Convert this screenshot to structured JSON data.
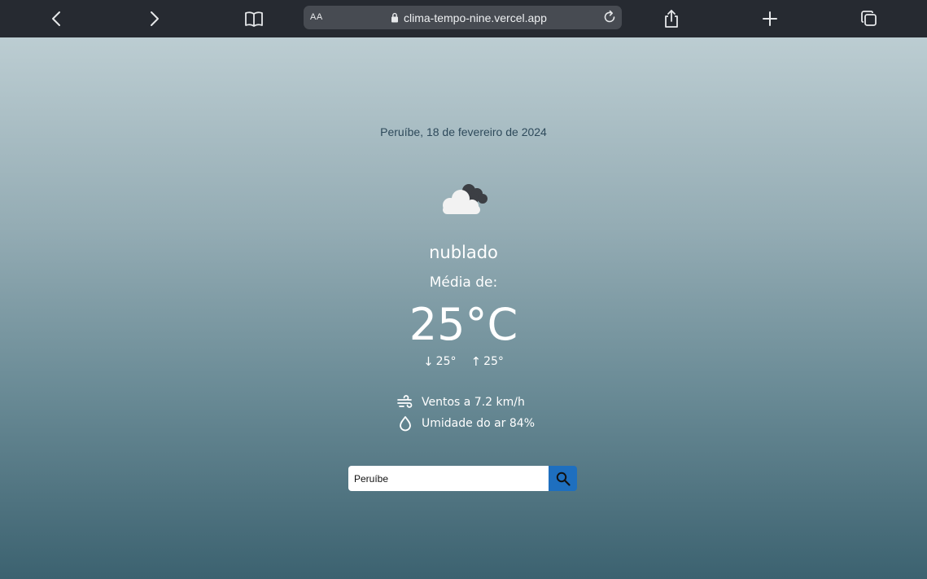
{
  "browser": {
    "text_size_label": "AA",
    "url": "clima-tempo-nine.vercel.app"
  },
  "weather": {
    "location_date": "Peruíbe, 18 de fevereiro de 2024",
    "icon": "cloudy-icon",
    "condition": "nublado",
    "average_label": "Média de:",
    "temperature": "25°C",
    "min_arrow": "↓",
    "min": "25°",
    "max_arrow": "↑",
    "max": "25°",
    "wind": "Ventos a 7.2 km/h",
    "humidity": "Umidade do ar 84%"
  },
  "search": {
    "value": "Peruíbe"
  },
  "colors": {
    "toolbar": "#262a31",
    "gradient_top": "#bccdd2",
    "gradient_bottom": "#3c6270",
    "search_button": "#1e6fbf"
  }
}
